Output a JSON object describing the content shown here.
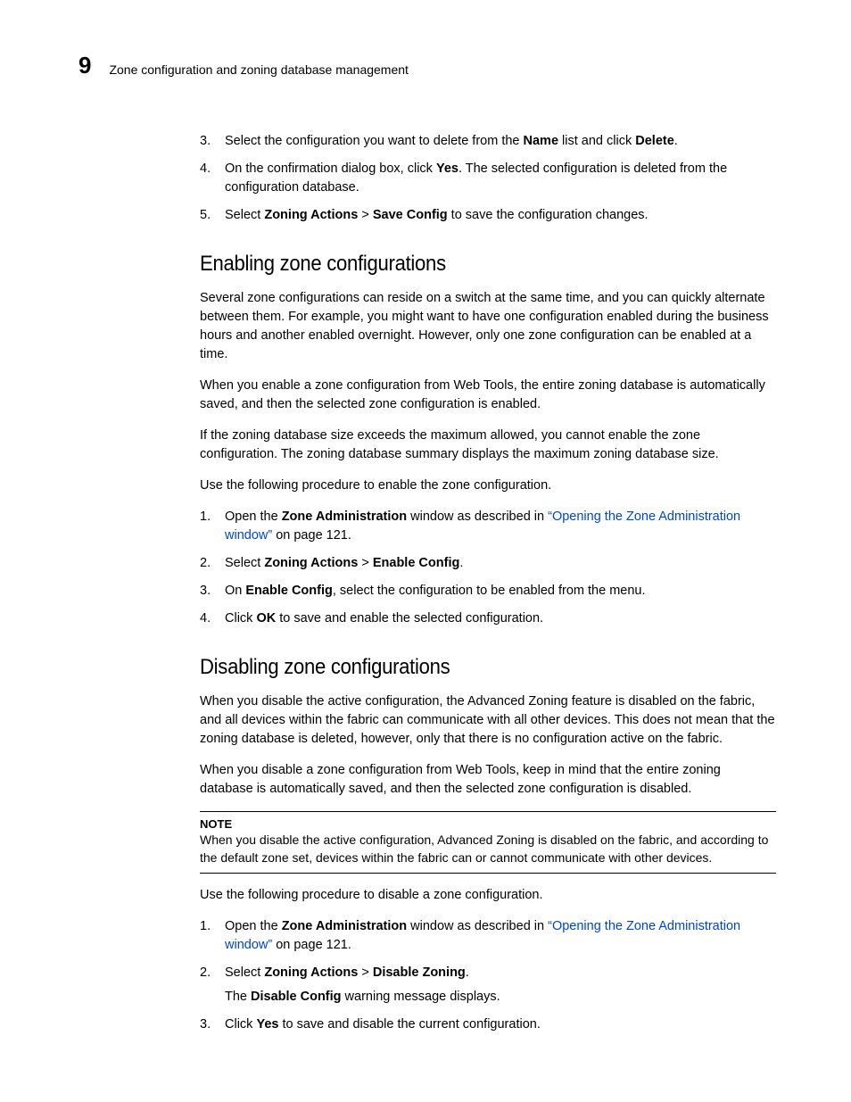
{
  "header": {
    "chapter_number": "9",
    "running_title": "Zone configuration and zoning database management"
  },
  "top_steps_start": 2,
  "top_steps": {
    "s3_pre": "Select the configuration you want to delete from the ",
    "s3_b1": "Name",
    "s3_mid": " list and click ",
    "s3_b2": "Delete",
    "s3_post": ".",
    "s4_pre": "On the confirmation dialog box, click ",
    "s4_b1": "Yes",
    "s4_post": ". The selected configuration is deleted from the configuration database.",
    "s5_pre": "Select ",
    "s5_b1": "Zoning Actions",
    "s5_mid": " > ",
    "s5_b2": "Save Config",
    "s5_post": " to save the configuration changes."
  },
  "enable": {
    "heading": "Enabling zone configurations",
    "p1": "Several zone configurations can reside on a switch at the same time, and you can quickly alternate between them. For example, you might want to have one configuration enabled during the business hours and another enabled overnight. However, only one zone configuration can be enabled at a time.",
    "p2": "When you enable a zone configuration from Web Tools, the entire zoning database is automatically saved, and then the selected zone configuration is enabled.",
    "p3": "If the zoning database size exceeds the maximum allowed, you cannot enable the zone configuration. The zoning database summary displays the maximum zoning database size.",
    "p4": "Use the following procedure to enable the zone configuration.",
    "steps": {
      "s1_pre": "Open the ",
      "s1_b1": "Zone Administration",
      "s1_mid": " window as described in ",
      "s1_link": "“Opening the Zone Administration window”",
      "s1_post": " on page 121.",
      "s2_pre": "Select ",
      "s2_b1": "Zoning Actions",
      "s2_mid": " > ",
      "s2_b2": "Enable Config",
      "s2_post": ".",
      "s3_pre": "On ",
      "s3_b1": "Enable Config",
      "s3_post": ", select the configuration to be enabled from the menu.",
      "s4_pre": "Click ",
      "s4_b1": "OK",
      "s4_post": " to save and enable the selected configuration."
    }
  },
  "disable": {
    "heading": "Disabling zone configurations",
    "p1": "When you disable the active configuration, the Advanced Zoning feature is disabled on the fabric, and all devices within the fabric can communicate with all other devices. This does not mean that the zoning database is deleted, however, only that there is no configuration active on the fabric.",
    "p2": "When you disable a zone configuration from Web Tools, keep in mind that the entire zoning database is automatically saved, and then the selected zone configuration is disabled.",
    "note_label": "NOTE",
    "note_body": "When you disable the active configuration, Advanced Zoning is disabled on the fabric, and according to the default zone set, devices within the fabric can or cannot communicate with other devices.",
    "p3": "Use the following procedure to disable a zone configuration.",
    "steps": {
      "s1_pre": "Open the ",
      "s1_b1": "Zone Administration",
      "s1_mid": " window as described in ",
      "s1_link": "“Opening the Zone Administration window”",
      "s1_post": " on page 121.",
      "s2_pre": "Select ",
      "s2_b1": "Zoning Actions",
      "s2_mid": " > ",
      "s2_b2": "Disable Zoning",
      "s2_post": ".",
      "s2_sub_pre": "The ",
      "s2_sub_b": "Disable Config",
      "s2_sub_post": " warning message displays.",
      "s3_pre": "Click ",
      "s3_b1": "Yes",
      "s3_post": " to save and disable the current configuration."
    }
  }
}
